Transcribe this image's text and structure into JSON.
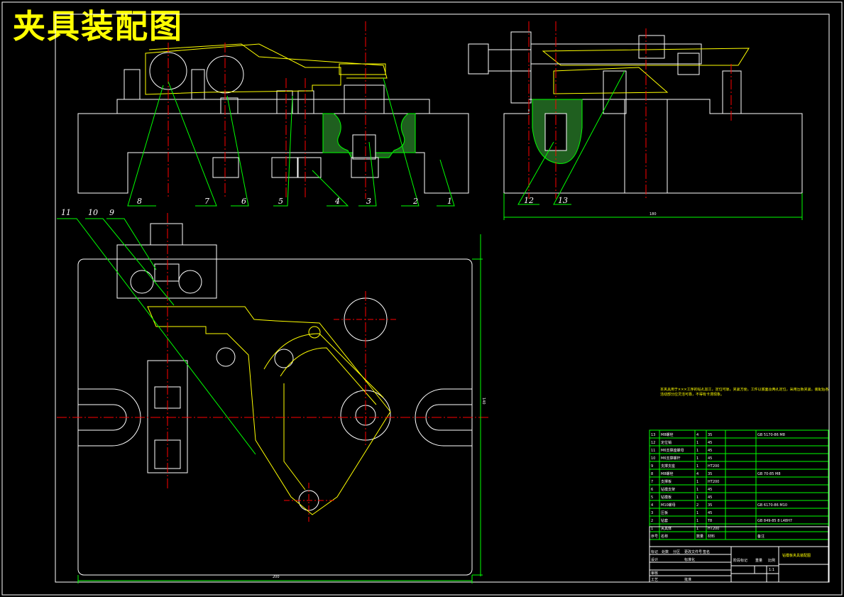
{
  "title": "夹具装配图",
  "callouts_top": [
    "8",
    "7",
    "6",
    "5",
    "4",
    "3",
    "2",
    "1"
  ],
  "callouts_side": [
    "12",
    "13"
  ],
  "callouts_plan": [
    "11",
    "10",
    "9"
  ],
  "dimensions": {
    "side_width": "180",
    "plan_width": "200",
    "plan_height": "140"
  },
  "notes": "本夹具用于×××工序的钻孔加工，定位可靠，夹紧方便。工件以底面及两孔定位，采用压板夹紧。装配后各活动部分应灵活可靠，不得有卡滞现象。",
  "bom": {
    "rows": [
      {
        "no": "13",
        "name": "M8螺栓",
        "qty": "4",
        "mat": "35",
        "std": "GB 5170-86 M8"
      },
      {
        "no": "12",
        "name": "定位销",
        "qty": "1",
        "mat": "45",
        "std": ""
      },
      {
        "no": "11",
        "name": "M6支撑座螺母",
        "qty": "1",
        "mat": "45",
        "std": ""
      },
      {
        "no": "10",
        "name": "M6支撑螺杆",
        "qty": "1",
        "mat": "45",
        "std": ""
      },
      {
        "no": "9",
        "name": "支撑支座",
        "qty": "1",
        "mat": "HT200",
        "std": ""
      },
      {
        "no": "8",
        "name": "M8螺栓",
        "qty": "4",
        "mat": "35",
        "std": "GB 70-85 M8"
      },
      {
        "no": "7",
        "name": "支撑板",
        "qty": "1",
        "mat": "HT200",
        "std": ""
      },
      {
        "no": "6",
        "name": "钻模支架",
        "qty": "1",
        "mat": "45",
        "std": ""
      },
      {
        "no": "5",
        "name": "钻模板",
        "qty": "1",
        "mat": "45",
        "std": ""
      },
      {
        "no": "4",
        "name": "M10螺母",
        "qty": "2",
        "mat": "35",
        "std": "GB 6170-86 M10"
      },
      {
        "no": "3",
        "name": "压板",
        "qty": "1",
        "mat": "45",
        "std": ""
      },
      {
        "no": "2",
        "name": "钻套",
        "qty": "1",
        "mat": "T8",
        "std": "GB 849-85 8 L48H7"
      },
      {
        "no": "1",
        "name": "夹具体",
        "qty": "1",
        "mat": "HT200",
        "std": ""
      }
    ],
    "header": {
      "no": "序号",
      "name": "名称",
      "qty": "数量",
      "mat": "材料",
      "std": "备注"
    }
  },
  "title_block": {
    "drawing_name": "钻模板夹具装配图",
    "labels": [
      "标记",
      "处数",
      "分区",
      "更改文件号",
      "签名",
      "设计",
      "标准化",
      "审核",
      "工艺",
      "批准"
    ],
    "stage_label": "阶段标记",
    "weight_label": "重量",
    "scale_label": "比例",
    "scale": "1:1"
  }
}
